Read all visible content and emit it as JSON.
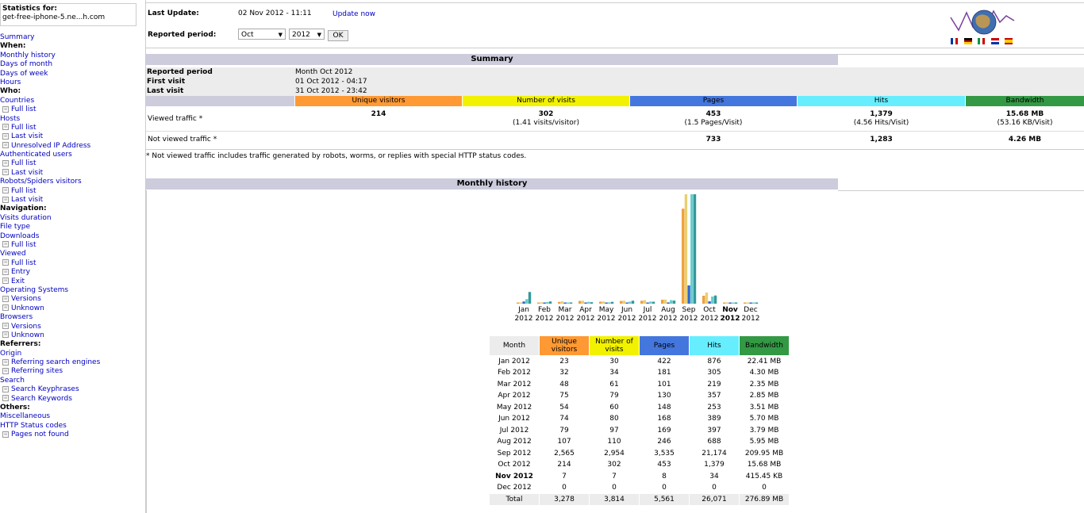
{
  "sidebar": {
    "stats_title": "Statistics for:",
    "stats_site": "get-free-iphone-5.ne...h.com",
    "items": [
      {
        "label": "Summary",
        "type": "link"
      },
      {
        "label": "When:",
        "type": "sec"
      },
      {
        "label": "Monthly history",
        "type": "link"
      },
      {
        "label": "Days of month",
        "type": "link"
      },
      {
        "label": "Days of week",
        "type": "link"
      },
      {
        "label": "Hours",
        "type": "link"
      },
      {
        "label": "Who:",
        "type": "sec"
      },
      {
        "label": "Countries",
        "type": "link"
      },
      {
        "label": "Full list",
        "type": "sub"
      },
      {
        "label": "Hosts",
        "type": "link"
      },
      {
        "label": "Full list",
        "type": "sub"
      },
      {
        "label": "Last visit",
        "type": "sub"
      },
      {
        "label": "Unresolved IP Address",
        "type": "sub"
      },
      {
        "label": "Authenticated users",
        "type": "link"
      },
      {
        "label": "Full list",
        "type": "sub"
      },
      {
        "label": "Last visit",
        "type": "sub"
      },
      {
        "label": "Robots/Spiders visitors",
        "type": "link"
      },
      {
        "label": "Full list",
        "type": "sub"
      },
      {
        "label": "Last visit",
        "type": "sub"
      },
      {
        "label": "Navigation:",
        "type": "sec"
      },
      {
        "label": "Visits duration",
        "type": "link"
      },
      {
        "label": "File type",
        "type": "link"
      },
      {
        "label": "Downloads",
        "type": "link"
      },
      {
        "label": "Full list",
        "type": "sub"
      },
      {
        "label": "Viewed",
        "type": "link"
      },
      {
        "label": "Full list",
        "type": "sub"
      },
      {
        "label": "Entry",
        "type": "sub"
      },
      {
        "label": "Exit",
        "type": "sub"
      },
      {
        "label": "Operating Systems",
        "type": "link"
      },
      {
        "label": "Versions",
        "type": "sub"
      },
      {
        "label": "Unknown",
        "type": "sub"
      },
      {
        "label": "Browsers",
        "type": "link"
      },
      {
        "label": "Versions",
        "type": "sub"
      },
      {
        "label": "Unknown",
        "type": "sub"
      },
      {
        "label": "Referrers:",
        "type": "sec"
      },
      {
        "label": "Origin",
        "type": "link"
      },
      {
        "label": "Referring search engines",
        "type": "sub"
      },
      {
        "label": "Referring sites",
        "type": "sub"
      },
      {
        "label": "Search",
        "type": "link"
      },
      {
        "label": "Search Keyphrases",
        "type": "sub"
      },
      {
        "label": "Search Keywords",
        "type": "sub"
      },
      {
        "label": "Others:",
        "type": "sec"
      },
      {
        "label": "Miscellaneous",
        "type": "link"
      },
      {
        "label": "HTTP Status codes",
        "type": "link"
      },
      {
        "label": "Pages not found",
        "type": "sub"
      }
    ]
  },
  "header": {
    "last_update_label": "Last Update:",
    "last_update_value": "02 Nov 2012 - 11:11",
    "update_now": "Update now",
    "reported_period_label": "Reported period:",
    "month_selected": "Oct",
    "year_selected": "2012",
    "ok": "OK"
  },
  "summary": {
    "title": "Summary",
    "reported_period_label": "Reported period",
    "reported_period_value": "Month Oct 2012",
    "first_visit_label": "First visit",
    "first_visit_value": "01 Oct 2012 - 04:17",
    "last_visit_label": "Last visit",
    "last_visit_value": "31 Oct 2012 - 23:42",
    "columns": [
      "Unique visitors",
      "Number of visits",
      "Pages",
      "Hits",
      "Bandwidth"
    ],
    "viewed_label": "Viewed traffic *",
    "viewed": {
      "unique": "214",
      "visits": "302",
      "visits_sub": "(1.41 visits/visitor)",
      "pages": "453",
      "pages_sub": "(1.5 Pages/Visit)",
      "hits": "1,379",
      "hits_sub": "(4.56 Hits/Visit)",
      "bw": "15.68 MB",
      "bw_sub": "(53.16 KB/Visit)"
    },
    "notviewed_label": "Not viewed traffic *",
    "notviewed": {
      "pages": "733",
      "hits": "1,283",
      "bw": "4.26 MB"
    },
    "note": "* Not viewed traffic includes traffic generated by robots, worms, or replies with special HTTP status codes."
  },
  "monthly": {
    "title": "Monthly history",
    "headers": [
      "Month",
      "Unique visitors",
      "Number of visits",
      "Pages",
      "Hits",
      "Bandwidth"
    ],
    "rows": [
      [
        "Jan 2012",
        "23",
        "30",
        "422",
        "876",
        "22.41 MB"
      ],
      [
        "Feb 2012",
        "32",
        "34",
        "181",
        "305",
        "4.30 MB"
      ],
      [
        "Mar 2012",
        "48",
        "61",
        "101",
        "219",
        "2.35 MB"
      ],
      [
        "Apr 2012",
        "75",
        "79",
        "130",
        "357",
        "2.85 MB"
      ],
      [
        "May 2012",
        "54",
        "60",
        "148",
        "253",
        "3.51 MB"
      ],
      [
        "Jun 2012",
        "74",
        "80",
        "168",
        "389",
        "5.70 MB"
      ],
      [
        "Jul 2012",
        "79",
        "97",
        "169",
        "397",
        "3.79 MB"
      ],
      [
        "Aug 2012",
        "107",
        "110",
        "246",
        "688",
        "5.95 MB"
      ],
      [
        "Sep 2012",
        "2,565",
        "2,954",
        "3,535",
        "21,174",
        "209.95 MB"
      ],
      [
        "Oct 2012",
        "214",
        "302",
        "453",
        "1,379",
        "15.68 MB"
      ],
      [
        "Nov 2012",
        "7",
        "7",
        "8",
        "34",
        "415.45 KB"
      ],
      [
        "Dec 2012",
        "0",
        "0",
        "0",
        "0",
        "0"
      ]
    ],
    "total": [
      "Total",
      "3,278",
      "3,814",
      "5,561",
      "26,071",
      "276.89 MB"
    ]
  },
  "chart_data": {
    "type": "bar",
    "categories": [
      "Jan",
      "Feb",
      "Mar",
      "Apr",
      "May",
      "Jun",
      "Jul",
      "Aug",
      "Sep",
      "Oct",
      "Nov",
      "Dec"
    ],
    "year_labels": [
      "2012",
      "2012",
      "2012",
      "2012",
      "2012",
      "2012",
      "2012",
      "2012",
      "2012",
      "2012",
      "2012",
      "2012"
    ],
    "highlight": "Nov",
    "series": [
      {
        "name": "Unique visitors",
        "values": [
          23,
          32,
          48,
          75,
          54,
          74,
          79,
          107,
          2565,
          214,
          7,
          0
        ]
      },
      {
        "name": "Number of visits",
        "values": [
          30,
          34,
          61,
          79,
          60,
          80,
          97,
          110,
          2954,
          302,
          7,
          0
        ]
      },
      {
        "name": "Pages",
        "values": [
          422,
          181,
          101,
          130,
          148,
          168,
          169,
          246,
          3535,
          453,
          8,
          0
        ]
      },
      {
        "name": "Hits",
        "values": [
          876,
          305,
          219,
          357,
          253,
          389,
          397,
          688,
          21174,
          1379,
          34,
          0
        ]
      },
      {
        "name": "Bandwidth (MB)",
        "values": [
          22.41,
          4.3,
          2.35,
          2.85,
          3.51,
          5.7,
          3.79,
          5.95,
          209.95,
          15.68,
          0.41,
          0
        ]
      }
    ]
  },
  "colors": {
    "unique": "#ff9933",
    "visits": "#f2f200",
    "pages": "#4477dd",
    "hits": "#66eeff",
    "bw": "#339944",
    "bar_unique": "#f0a040",
    "bar_visits": "#e8d070",
    "bar_pages": "#3366cc",
    "bar_hits": "#66cccc",
    "bar_bw": "#339999"
  }
}
